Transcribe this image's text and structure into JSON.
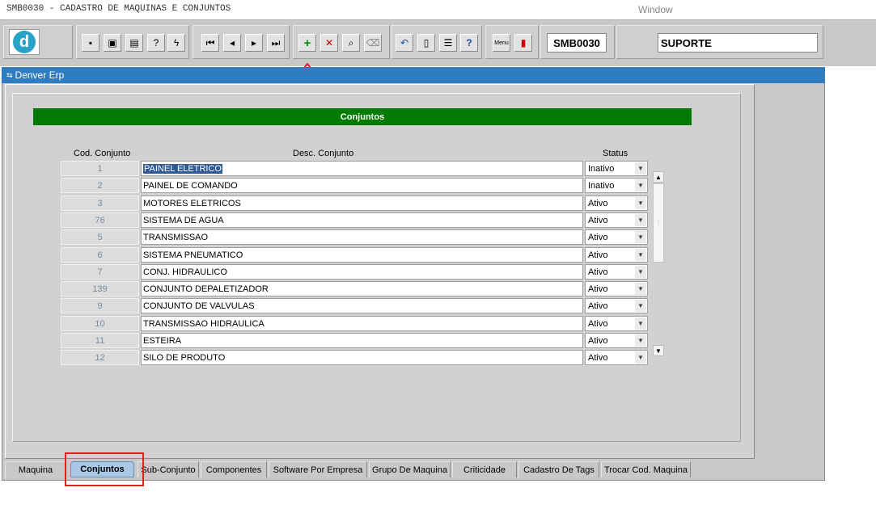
{
  "titlebar": {
    "app_title": "SMB0030 - CADASTRO DE MAQUINAS E CONJUNTOS",
    "window_menu": "Window"
  },
  "toolbar": {
    "module_code": "SMB0030",
    "user": "SUPORTE",
    "logo_letter": "d",
    "icons": [
      "save-icon",
      "print-preview-icon",
      "print-icon",
      "help-query-icon",
      "execute-query-icon",
      "first-record-icon",
      "previous-record-icon",
      "next-record-icon",
      "last-record-icon",
      "insert-record-icon",
      "delete-record-icon",
      "query-icon",
      "clear-icon",
      "undo-icon",
      "paste-icon",
      "list-of-values-icon",
      "help-icon",
      "menu-icon",
      "exit-icon"
    ],
    "menu_label": "Menu"
  },
  "window": {
    "title": "Denver Erp"
  },
  "section": {
    "title": "Conjuntos"
  },
  "columns": {
    "code": "Cod. Conjunto",
    "desc": "Desc. Conjunto",
    "status": "Status"
  },
  "rows": [
    {
      "code": "1",
      "desc": "PAINEL ELETRICO",
      "status": "Inativo"
    },
    {
      "code": "2",
      "desc": "PAINEL DE COMANDO",
      "status": "Inativo"
    },
    {
      "code": "3",
      "desc": "MOTORES ELETRICOS",
      "status": "Ativo"
    },
    {
      "code": "76",
      "desc": "SISTEMA DE AGUA",
      "status": "Ativo"
    },
    {
      "code": "5",
      "desc": "TRANSMISSAO",
      "status": "Ativo"
    },
    {
      "code": "6",
      "desc": "SISTEMA PNEUMATICO",
      "status": "Ativo"
    },
    {
      "code": "7",
      "desc": "CONJ. HIDRAULICO",
      "status": "Ativo"
    },
    {
      "code": "139",
      "desc": "CONJUNTO DEPALETIZADOR",
      "status": "Ativo"
    },
    {
      "code": "9",
      "desc": "CONJUNTO DE VALVULAS",
      "status": "Ativo"
    },
    {
      "code": "10",
      "desc": "TRANSMISSAO HIDRAULICA",
      "status": "Ativo"
    },
    {
      "code": "11",
      "desc": "ESTEIRA",
      "status": "Ativo"
    },
    {
      "code": "12",
      "desc": "SILO DE PRODUTO",
      "status": "Ativo"
    }
  ],
  "tabs": [
    {
      "label": "Maquina"
    },
    {
      "label": "Conjuntos"
    },
    {
      "label": "Sub-Conjunto"
    },
    {
      "label": "Componentes"
    },
    {
      "label": "Software Por Empresa"
    },
    {
      "label": "Grupo De Maquina"
    },
    {
      "label": "Criticidade"
    },
    {
      "label": "Cadastro De Tags"
    },
    {
      "label": "Trocar Cod. Maquina"
    }
  ],
  "colors": {
    "title_blue": "#2f7dc0",
    "section_green": "#007a00",
    "highlight_red": "#e02020",
    "selection_blue": "#315a94"
  }
}
